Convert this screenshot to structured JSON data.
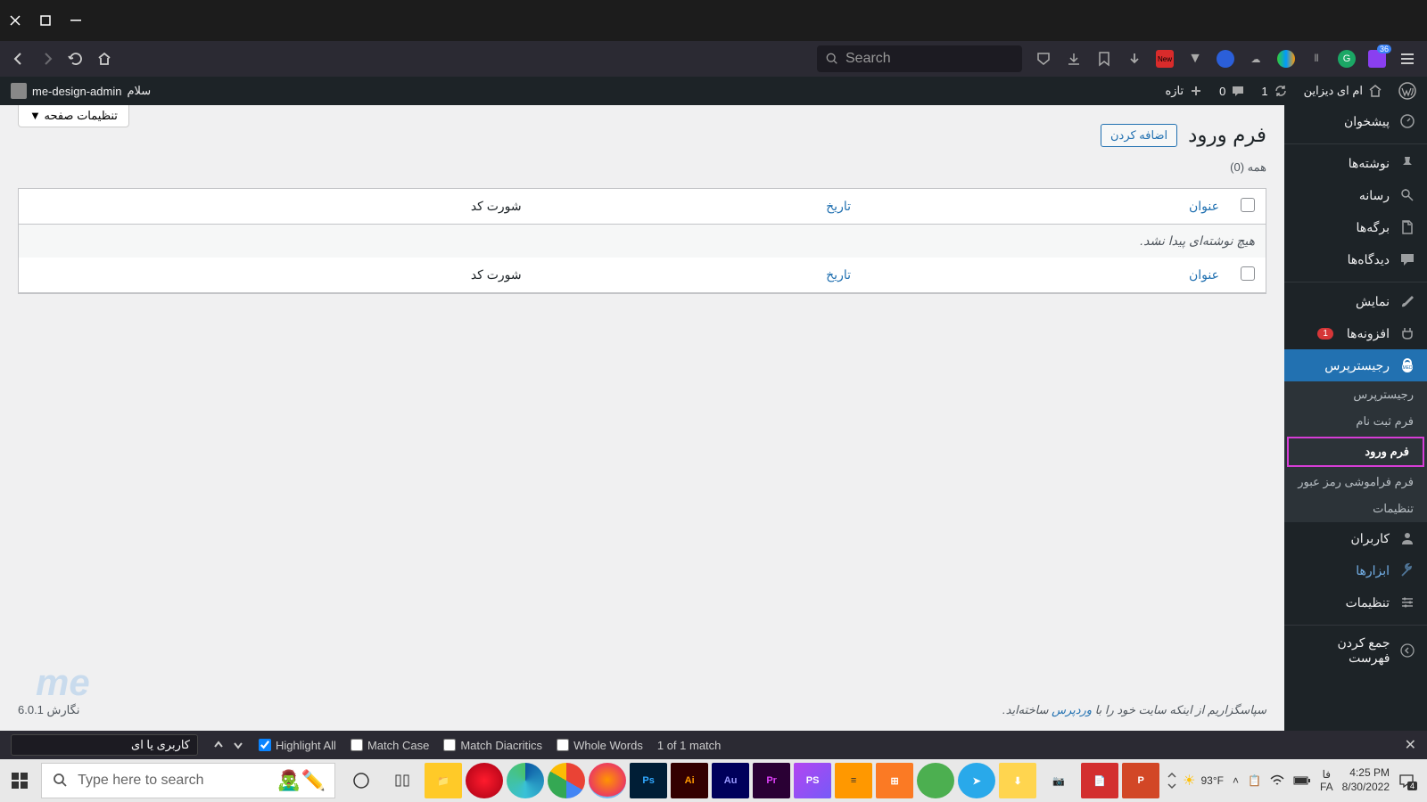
{
  "window": {
    "greeting": "سلام",
    "username": "me-design-admin"
  },
  "browser": {
    "search_placeholder": "Search",
    "ext_badge": "36",
    "ext_new": "New"
  },
  "wp_bar": {
    "site_name": "ام ای دیزاین",
    "updates": "1",
    "comments": "0",
    "new": "تازه"
  },
  "sidebar": {
    "dashboard": "پیشخوان",
    "posts": "نوشته‌ها",
    "media": "رسانه",
    "pages": "برگه‌ها",
    "comments": "دیدگاه‌ها",
    "appearance": "نمایش",
    "plugins": "افزونه‌ها",
    "plugins_count": "1",
    "register": "رجیسترپرس",
    "users": "کاربران",
    "tools": "ابزارها",
    "settings": "تنظیمات",
    "collapse": "جمع کردن فهرست",
    "sub": {
      "registerpress": "رجیسترپرس",
      "signup_form": "فرم ثبت نام",
      "login_form": "فرم ورود",
      "forgot_form": "فرم فراموشی رمز عبور",
      "settings": "تنظیمات"
    }
  },
  "content": {
    "screen_options": "تنظیمات صفحه",
    "title": "فرم ورود",
    "add_new": "اضافه کردن",
    "filter_all": "همه (0)",
    "col_title": "عنوان",
    "col_date": "تاریخ",
    "col_shortcode": "شورت کد",
    "no_items": "هیچ نوشته‌ای پیدا نشد."
  },
  "footer": {
    "thanks_pre": "سپاسگزاریم از اینکه سایت خود را با ",
    "wordpress": "وردپرس",
    "thanks_post": " ساخته‌اید.",
    "version": "نگارش 6.0.1"
  },
  "find": {
    "query": "کاربری یا ای",
    "highlight": "Highlight All",
    "match_case": "Match Case",
    "diacritics": "Match Diacritics",
    "whole_words": "Whole Words",
    "result": "1 of 1 match"
  },
  "taskbar": {
    "search_placeholder": "Type here to search",
    "temp": "93°F",
    "time": "4:25 PM",
    "date": "8/30/2022",
    "lang1": "فا",
    "lang2": "FA",
    "notif": "4"
  },
  "watermark": "me"
}
